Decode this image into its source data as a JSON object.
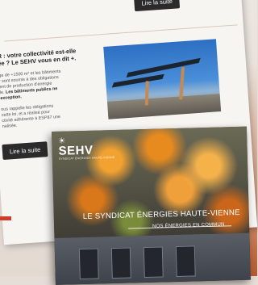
{
  "newsletter": {
    "btn_top": "Lire la suite",
    "btn_left": "Lire la suite",
    "article_title": "R : votre collectivité est-elle\née ? Le SEHV vous en dit +.",
    "article_body1_a": "ge de +1500 m² et les bâtiments\nr sont soumis à des obligations\nent de production d'énergie\nle. ",
    "article_body1_b": "Les bâtiments publics ne\nexception.",
    "article_body2": "ous rappelle les obligations\ncette loi, et a réalisé pour\nctivité adhérente à ESP87 une\nnalisée."
  },
  "brochure": {
    "logo_text": "SEHV",
    "logo_sub": "SYNDICAT ÉNERGIES HAUTE-VIENNE",
    "title": "LE SYNDICAT ÉNERGIES HAUTE-VIENNE",
    "tagline": "NOS ÉNERGIES EN COMMUN"
  },
  "colors": {
    "button_bg": "#2b2b2b",
    "accent_red": "#d23a2a"
  },
  "icons": {
    "logo_mark": "sun-icon"
  }
}
